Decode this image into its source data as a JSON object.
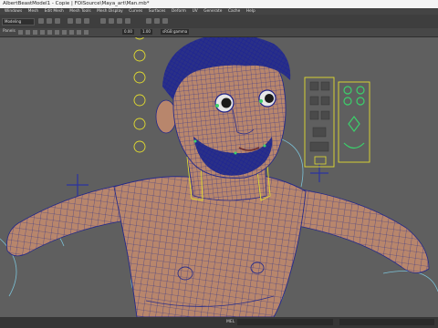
{
  "window": {
    "title": "AlbertBeastModel1 - Copie | FOISource\\Maya_art\\Man.mb*"
  },
  "menubar": {
    "items": [
      "Windows",
      "Mesh",
      "Edit Mesh",
      "Mesh Tools",
      "Mesh Display",
      "Curves",
      "Surfaces",
      "Deform",
      "UV",
      "Generate",
      "Cache",
      "Help"
    ]
  },
  "statusline": {
    "mode": "Modeling"
  },
  "panel": {
    "menu_label": "Panels",
    "value_a": "0.00",
    "value_b": "1.00",
    "colorspace": "sRGB gamma"
  },
  "bottom": {
    "mel_label": "MEL"
  },
  "colors": {
    "wire_blue": "#22299a",
    "skin": "#b8866c",
    "controller_yellow": "#e2dc2f",
    "controller_green": "#3bd06b",
    "curve_cyan": "#7bc1d6"
  }
}
